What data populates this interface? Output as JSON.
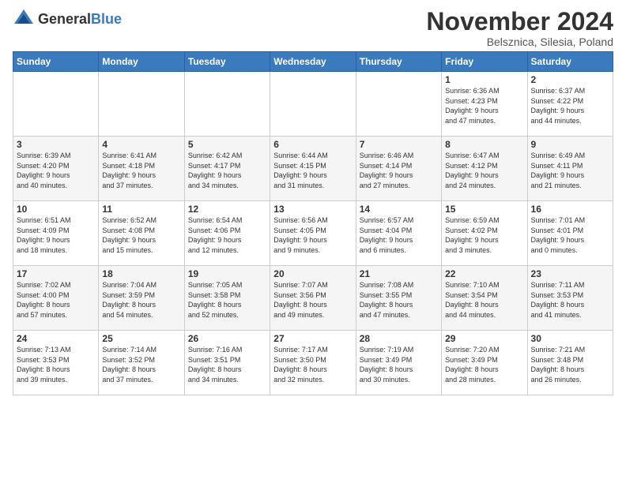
{
  "header": {
    "logo_general": "General",
    "logo_blue": "Blue",
    "month_title": "November 2024",
    "location": "Belsznica, Silesia, Poland"
  },
  "days_of_week": [
    "Sunday",
    "Monday",
    "Tuesday",
    "Wednesday",
    "Thursday",
    "Friday",
    "Saturday"
  ],
  "weeks": [
    [
      {
        "day": "",
        "info": ""
      },
      {
        "day": "",
        "info": ""
      },
      {
        "day": "",
        "info": ""
      },
      {
        "day": "",
        "info": ""
      },
      {
        "day": "",
        "info": ""
      },
      {
        "day": "1",
        "info": "Sunrise: 6:36 AM\nSunset: 4:23 PM\nDaylight: 9 hours\nand 47 minutes."
      },
      {
        "day": "2",
        "info": "Sunrise: 6:37 AM\nSunset: 4:22 PM\nDaylight: 9 hours\nand 44 minutes."
      }
    ],
    [
      {
        "day": "3",
        "info": "Sunrise: 6:39 AM\nSunset: 4:20 PM\nDaylight: 9 hours\nand 40 minutes."
      },
      {
        "day": "4",
        "info": "Sunrise: 6:41 AM\nSunset: 4:18 PM\nDaylight: 9 hours\nand 37 minutes."
      },
      {
        "day": "5",
        "info": "Sunrise: 6:42 AM\nSunset: 4:17 PM\nDaylight: 9 hours\nand 34 minutes."
      },
      {
        "day": "6",
        "info": "Sunrise: 6:44 AM\nSunset: 4:15 PM\nDaylight: 9 hours\nand 31 minutes."
      },
      {
        "day": "7",
        "info": "Sunrise: 6:46 AM\nSunset: 4:14 PM\nDaylight: 9 hours\nand 27 minutes."
      },
      {
        "day": "8",
        "info": "Sunrise: 6:47 AM\nSunset: 4:12 PM\nDaylight: 9 hours\nand 24 minutes."
      },
      {
        "day": "9",
        "info": "Sunrise: 6:49 AM\nSunset: 4:11 PM\nDaylight: 9 hours\nand 21 minutes."
      }
    ],
    [
      {
        "day": "10",
        "info": "Sunrise: 6:51 AM\nSunset: 4:09 PM\nDaylight: 9 hours\nand 18 minutes."
      },
      {
        "day": "11",
        "info": "Sunrise: 6:52 AM\nSunset: 4:08 PM\nDaylight: 9 hours\nand 15 minutes."
      },
      {
        "day": "12",
        "info": "Sunrise: 6:54 AM\nSunset: 4:06 PM\nDaylight: 9 hours\nand 12 minutes."
      },
      {
        "day": "13",
        "info": "Sunrise: 6:56 AM\nSunset: 4:05 PM\nDaylight: 9 hours\nand 9 minutes."
      },
      {
        "day": "14",
        "info": "Sunrise: 6:57 AM\nSunset: 4:04 PM\nDaylight: 9 hours\nand 6 minutes."
      },
      {
        "day": "15",
        "info": "Sunrise: 6:59 AM\nSunset: 4:02 PM\nDaylight: 9 hours\nand 3 minutes."
      },
      {
        "day": "16",
        "info": "Sunrise: 7:01 AM\nSunset: 4:01 PM\nDaylight: 9 hours\nand 0 minutes."
      }
    ],
    [
      {
        "day": "17",
        "info": "Sunrise: 7:02 AM\nSunset: 4:00 PM\nDaylight: 8 hours\nand 57 minutes."
      },
      {
        "day": "18",
        "info": "Sunrise: 7:04 AM\nSunset: 3:59 PM\nDaylight: 8 hours\nand 54 minutes."
      },
      {
        "day": "19",
        "info": "Sunrise: 7:05 AM\nSunset: 3:58 PM\nDaylight: 8 hours\nand 52 minutes."
      },
      {
        "day": "20",
        "info": "Sunrise: 7:07 AM\nSunset: 3:56 PM\nDaylight: 8 hours\nand 49 minutes."
      },
      {
        "day": "21",
        "info": "Sunrise: 7:08 AM\nSunset: 3:55 PM\nDaylight: 8 hours\nand 47 minutes."
      },
      {
        "day": "22",
        "info": "Sunrise: 7:10 AM\nSunset: 3:54 PM\nDaylight: 8 hours\nand 44 minutes."
      },
      {
        "day": "23",
        "info": "Sunrise: 7:11 AM\nSunset: 3:53 PM\nDaylight: 8 hours\nand 41 minutes."
      }
    ],
    [
      {
        "day": "24",
        "info": "Sunrise: 7:13 AM\nSunset: 3:53 PM\nDaylight: 8 hours\nand 39 minutes."
      },
      {
        "day": "25",
        "info": "Sunrise: 7:14 AM\nSunset: 3:52 PM\nDaylight: 8 hours\nand 37 minutes."
      },
      {
        "day": "26",
        "info": "Sunrise: 7:16 AM\nSunset: 3:51 PM\nDaylight: 8 hours\nand 34 minutes."
      },
      {
        "day": "27",
        "info": "Sunrise: 7:17 AM\nSunset: 3:50 PM\nDaylight: 8 hours\nand 32 minutes."
      },
      {
        "day": "28",
        "info": "Sunrise: 7:19 AM\nSunset: 3:49 PM\nDaylight: 8 hours\nand 30 minutes."
      },
      {
        "day": "29",
        "info": "Sunrise: 7:20 AM\nSunset: 3:49 PM\nDaylight: 8 hours\nand 28 minutes."
      },
      {
        "day": "30",
        "info": "Sunrise: 7:21 AM\nSunset: 3:48 PM\nDaylight: 8 hours\nand 26 minutes."
      }
    ]
  ]
}
